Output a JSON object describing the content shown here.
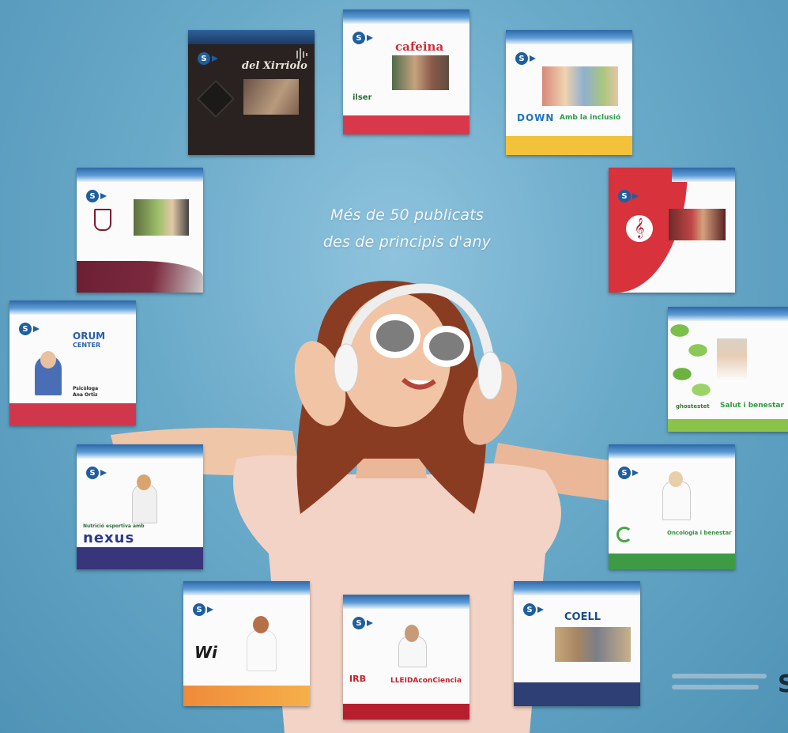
{
  "headline": {
    "line1": "Més de 50 publicats",
    "line2": "des de principis d'any"
  },
  "cards": {
    "xirriolo": {
      "title": "del Xirriolo"
    },
    "cafeina": {
      "title": "cafeina",
      "logo": "ilser"
    },
    "down": {
      "logo_down": "DOWN",
      "logo_tag": "Amb la inclusió"
    },
    "orum": {
      "logo": "ORUM",
      "sub": "CENTER",
      "caption": "Psicòloga",
      "caption2": "Ana Ortiz"
    },
    "pinol": {
      "caption": "Salut i benestar",
      "logo": "ghostestet"
    },
    "nexus": {
      "logo": "nexus",
      "caption": "Nutrició esportiva amb"
    },
    "oncologia": {
      "caption": "Oncologia i benestar"
    },
    "wi": {
      "logo": "Wi"
    },
    "lleida": {
      "caption": "LLEIDAconCiencia",
      "logo": "IRB"
    },
    "coell": {
      "logo": "COELL"
    }
  },
  "badge_letter": "S",
  "edge_letter": "S"
}
